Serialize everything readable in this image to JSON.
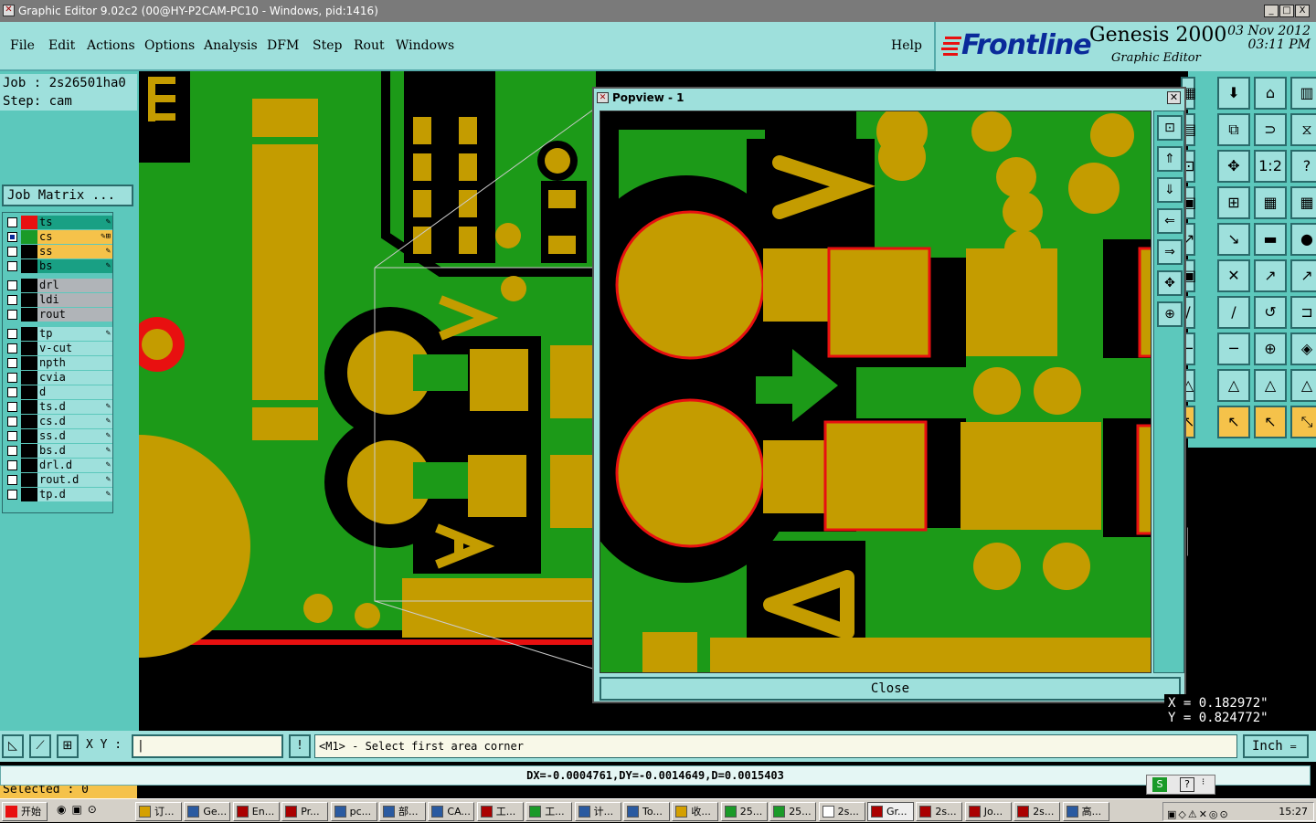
{
  "window": {
    "title": "Graphic Editor 9.02c2 (00@HY-P2CAM-PC10 - Windows, pid:1416)",
    "min": "_",
    "max": "□",
    "close": "X"
  },
  "menu": [
    "File",
    "Edit",
    "Actions",
    "Options",
    "Analysis",
    "DFM",
    "Step",
    "Rout",
    "Windows"
  ],
  "help": "Help",
  "brand": {
    "logo": "Frontline",
    "product": "Genesis 2000",
    "subtitle": "Graphic Editor",
    "date_line1": "03 Nov 2012",
    "date_line2": "03:11 PM"
  },
  "job": "Job : 2s26501ha0",
  "step": "Step: cam",
  "job_matrix": "Job Matrix ...",
  "layers": [
    {
      "name": "ts",
      "color": "#19a084",
      "swatch": "#e81010",
      "mark": "✎"
    },
    {
      "name": "cs",
      "color": "#f5c24a",
      "swatch": "#1a9a28",
      "mark": "✎⊞"
    },
    {
      "name": "ss",
      "color": "#f5c24a",
      "swatch": "#000000",
      "mark": "✎"
    },
    {
      "name": "bs",
      "color": "#19a084",
      "swatch": "#000000",
      "mark": "✎"
    },
    {
      "name": "drl",
      "color": "#b0b4b8",
      "swatch": "#000000",
      "mark": ""
    },
    {
      "name": "ldi",
      "color": "#b0b4b8",
      "swatch": "#000000",
      "mark": ""
    },
    {
      "name": "rout",
      "color": "#b0b4b8",
      "swatch": "#000000",
      "mark": ""
    },
    {
      "name": "tp",
      "color": "#9ee0dc",
      "swatch": "#000000",
      "mark": "✎"
    },
    {
      "name": "v-cut",
      "color": "#9ee0dc",
      "swatch": "#000000",
      "mark": ""
    },
    {
      "name": "npth",
      "color": "#9ee0dc",
      "swatch": "#000000",
      "mark": ""
    },
    {
      "name": "cvia",
      "color": "#9ee0dc",
      "swatch": "#000000",
      "mark": ""
    },
    {
      "name": "d",
      "color": "#9ee0dc",
      "swatch": "#000000",
      "mark": ""
    },
    {
      "name": "ts.d",
      "color": "#9ee0dc",
      "swatch": "#000000",
      "mark": "✎"
    },
    {
      "name": "cs.d",
      "color": "#9ee0dc",
      "swatch": "#000000",
      "mark": "✎"
    },
    {
      "name": "ss.d",
      "color": "#9ee0dc",
      "swatch": "#000000",
      "mark": "✎"
    },
    {
      "name": "bs.d",
      "color": "#9ee0dc",
      "swatch": "#000000",
      "mark": "✎"
    },
    {
      "name": "drl.d",
      "color": "#9ee0dc",
      "swatch": "#000000",
      "mark": "✎"
    },
    {
      "name": "rout.d",
      "color": "#9ee0dc",
      "swatch": "#000000",
      "mark": "✎"
    },
    {
      "name": "tp.d",
      "color": "#9ee0dc",
      "swatch": "#000000",
      "mark": "✎"
    }
  ],
  "selected": "Selected : 0",
  "popview": {
    "title": "Popview - 1",
    "close_label": "Close"
  },
  "coords": {
    "x": "X = 0.182972\"",
    "y": "Y = 0.824772\""
  },
  "command": {
    "xy_label": "X Y :",
    "prompt": "<M1> - Select first area corner",
    "unit": "Inch"
  },
  "status": "DX=-0.0004761,DY=-0.0014649,D=0.0015403",
  "taskbar": {
    "start": "开始",
    "tasks": [
      "订...",
      "Ge...",
      "En...",
      "Pr...",
      "pc...",
      "部...",
      "CA...",
      "工...",
      "工...",
      "计...",
      "To...",
      "收...",
      "25...",
      "25...",
      "2s...",
      "Gr...",
      "2s...",
      "Jo...",
      "2s...",
      "高..."
    ],
    "clock": "15:27"
  },
  "colors": {
    "board": "#1c9a18",
    "copper": "#c49c00",
    "pad_outline": "#e81010",
    "ui": "#9ee0dc",
    "panel": "#5cc8bc"
  }
}
